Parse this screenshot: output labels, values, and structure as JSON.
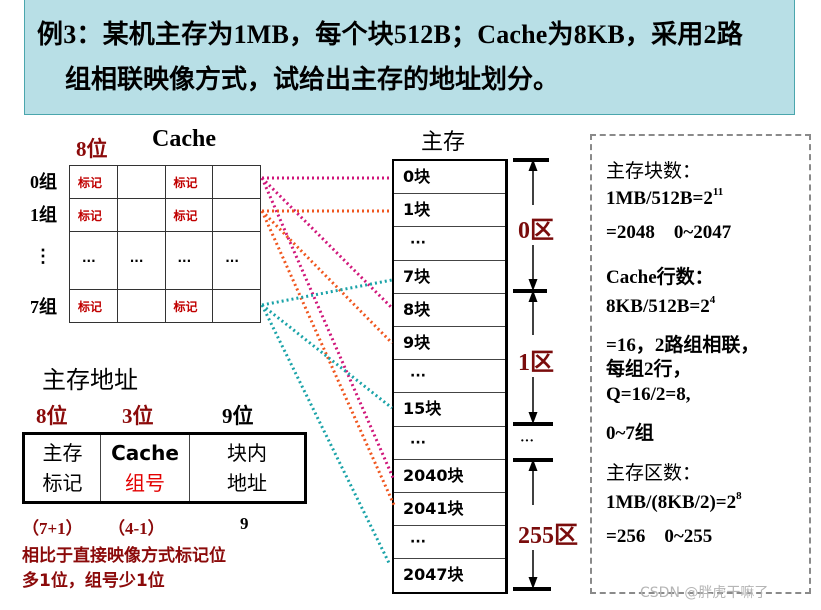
{
  "header": {
    "line1": "例3：某机主存为1MB，每个块512B；Cache为8KB，采用2路",
    "line2": "组相联映像方式，试给出主存的地址划分。"
  },
  "cache": {
    "title": "Cache",
    "tag_bits": "8位",
    "groups": [
      "0组",
      "1组",
      "⋮",
      "7组"
    ],
    "tag_label": "标记",
    "ellipsis": "···"
  },
  "main_memory": {
    "title": "主存",
    "blocks": [
      "0块",
      "1块",
      "···",
      "7块",
      "8块",
      "9块",
      "···",
      "15块",
      "···",
      "2040块",
      "2041块",
      "···",
      "2047块"
    ],
    "zones": [
      "0区",
      "1区",
      "255区"
    ],
    "zone_gap": "···"
  },
  "info": {
    "block_count_title": "主存块数：",
    "block_count_formula": "1MB/512B=2",
    "block_count_exp": "11",
    "block_count_result": "=2048    0~2047",
    "cache_lines_title": "Cache行数：",
    "cache_lines_formula": "8KB/512B=2",
    "cache_lines_exp": "4",
    "cache_lines_result": "=16，2路组相联，",
    "per_group": "每组2行，",
    "q": "Q=16/2=8,",
    "group_range": "0~7组",
    "zone_count_title": "主存区数：",
    "zone_count_formula": "1MB/(8KB/2)=2",
    "zone_count_exp": "8",
    "zone_count_result": "=256    0~255"
  },
  "address": {
    "title": "主存地址",
    "fields": [
      {
        "bits": "8位",
        "line1": "主存",
        "line2": "标记",
        "below": "（7+1）"
      },
      {
        "bits": "3位",
        "line1": "Cache",
        "line2": "组号",
        "below": "（4-1）"
      },
      {
        "bits": "9位",
        "line1": "块内",
        "line2": "地址",
        "below": "9"
      }
    ],
    "note_line1": "相比于直接映像方式标记位",
    "note_line2": "多1位，组号少1位"
  },
  "colors": {
    "header_bg": "#b8dfe6",
    "magenta_line": "#d0167a",
    "orange_line": "#f0561e",
    "teal_line": "#1aa3a8",
    "dark_red": "#8b0a0a"
  },
  "watermark": "CSDN @胖虎干嘛了"
}
